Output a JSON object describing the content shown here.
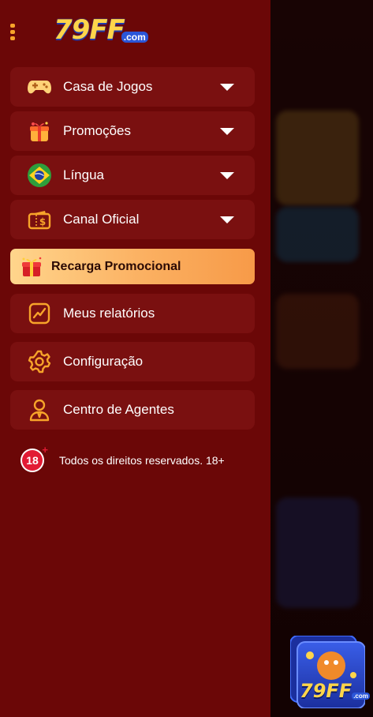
{
  "logo": {
    "main": "79FF",
    "suffix": ".com"
  },
  "menu": [
    {
      "label": "Casa de Jogos",
      "icon": "gamepad-icon",
      "expandable": true
    },
    {
      "label": "Promoções",
      "icon": "gift-box-icon",
      "expandable": true
    },
    {
      "label": "Língua",
      "icon": "brazil-flag-icon",
      "expandable": true
    },
    {
      "label": "Canal Oficial",
      "icon": "ticket-dollar-icon",
      "expandable": true
    }
  ],
  "promo": {
    "label": "Recarga Promocional",
    "icon": "red-gift-icon"
  },
  "links": [
    {
      "label": "Meus relatórios",
      "icon": "chart-line-icon"
    },
    {
      "label": "Configuração",
      "icon": "gear-icon"
    },
    {
      "label": "Centro de Agentes",
      "icon": "agent-person-icon"
    }
  ],
  "footer": {
    "badge": "18",
    "text": "Todos os direitos reservados. 18+"
  },
  "floating_app": {
    "label": "79FF",
    "suffix": ".com"
  },
  "colors": {
    "drawer": "#6b0707",
    "item": "#7a1010",
    "accent": "#f7a42a",
    "promo_start": "#ffd58c",
    "promo_end": "#f79a48"
  }
}
